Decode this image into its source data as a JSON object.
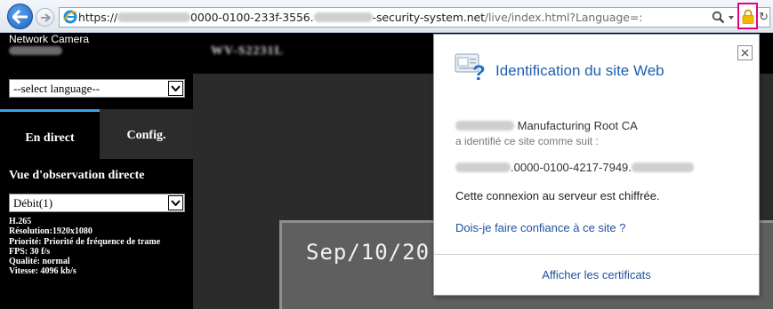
{
  "browser": {
    "url": {
      "scheme": "https://",
      "host_part_1": "0000-0100-233f-3556.",
      "host_part_2": "-security-system.net",
      "path": "/live/index.html?Language=:"
    },
    "icons": {
      "back": "back-arrow-icon",
      "forward": "forward-arrow-icon",
      "page": "internet-explorer-icon",
      "search": "search-icon",
      "lock": "lock-icon",
      "refresh": "refresh-icon"
    },
    "colors": {
      "lock_highlight": "#e3007f",
      "lock": "#f5b800",
      "back": "#1d64c2"
    }
  },
  "camera": {
    "brand": "Network Camera",
    "language_select": "--select language--",
    "tabs": [
      {
        "label": "En direct",
        "active": true
      },
      {
        "label": "Config.",
        "active": false
      }
    ],
    "live_view_title": "Vue d'observation directe",
    "stream_select": "Débit(1)",
    "info": {
      "codec": "H.265",
      "resolution": "Résolution:1920x1080",
      "priority": "Priorité: Priorité de fréquence de trame",
      "fps": "FPS: 30 f/s",
      "quality": "Qualité: normal",
      "speed": "Vitesse:  4096 kb/s"
    },
    "video_date": "Sep/10/20",
    "colors": {
      "active_tab_accent": "#3aa0e8"
    }
  },
  "popup": {
    "title": "Identification du site Web",
    "issuer": "Manufacturing Root CA",
    "identified": "a identifié ce site comme suit :",
    "site_id": ".0000-0100-4217-7949.",
    "encrypted": "Cette connexion au serveur est chiffrée.",
    "trust_link": "Dois-je faire confiance à ce site ?",
    "cert_link": "Afficher les certificats",
    "icons": {
      "identity": "site-identity-icon",
      "close": "close-icon"
    },
    "colors": {
      "title": "#1f5fb0",
      "link": "#1f4f9e"
    }
  }
}
